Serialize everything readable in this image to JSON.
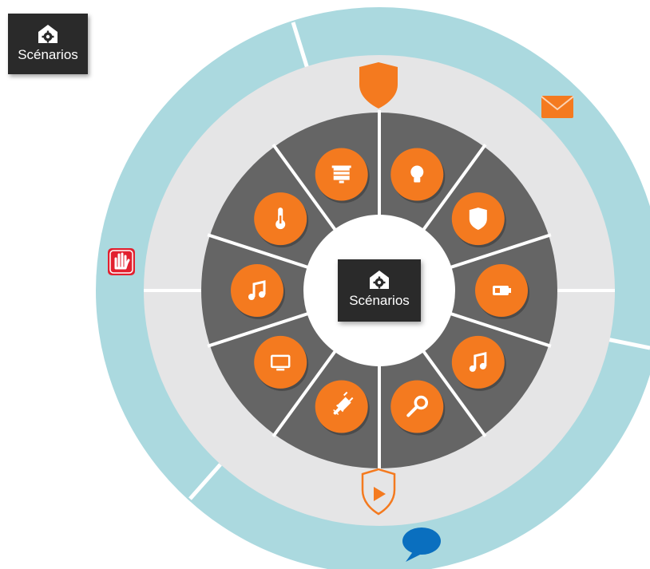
{
  "colors": {
    "outer_ring": "#abd9df",
    "middle_ring": "#e5e5e6",
    "inner_ring": "#656565",
    "center": "#ffffff",
    "button_orange": "#f47a1f",
    "tile_dark": "#2a2a2a",
    "alert_red": "#e2202f",
    "chat_blue": "#0a6fbf"
  },
  "corner_tile": {
    "label": "Scénarios",
    "icon": "home-gear-icon"
  },
  "center_tile": {
    "label": "Scénarios",
    "icon": "home-gear-icon"
  },
  "ring_buttons": [
    {
      "name": "shutters",
      "icon": "roller-shutter-icon"
    },
    {
      "name": "lighting",
      "icon": "lightbulb-icon"
    },
    {
      "name": "security",
      "icon": "shield-icon"
    },
    {
      "name": "battery",
      "icon": "battery-icon"
    },
    {
      "name": "music-right",
      "icon": "music-note-icon"
    },
    {
      "name": "access",
      "icon": "key-icon"
    },
    {
      "name": "power",
      "icon": "power-plug-icon"
    },
    {
      "name": "tv",
      "icon": "tv-icon"
    },
    {
      "name": "music-left",
      "icon": "music-note-icon"
    },
    {
      "name": "temperature",
      "icon": "thermometer-icon"
    }
  ],
  "outer_icons": [
    {
      "name": "top-shield",
      "icon": "shield-icon"
    },
    {
      "name": "mail",
      "icon": "envelope-icon"
    },
    {
      "name": "stop",
      "icon": "hand-stop-icon"
    },
    {
      "name": "scenario-play",
      "icon": "shield-play-icon"
    },
    {
      "name": "chat",
      "icon": "speech-bubble-icon"
    }
  ]
}
